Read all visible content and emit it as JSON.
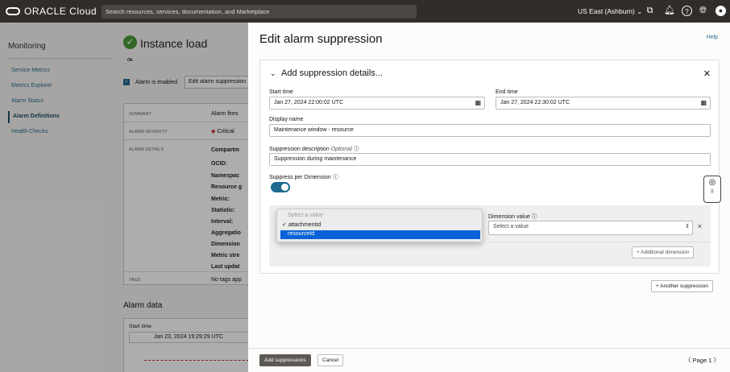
{
  "header": {
    "brand": "ORACLE Cloud",
    "search_placeholder": "Search resources, services, documentation, and Marketplace",
    "region": "US East (Ashburn)"
  },
  "sidebar": {
    "title": "Monitoring",
    "items": [
      {
        "label": "Service Metrics"
      },
      {
        "label": "Metrics Explorer"
      },
      {
        "label": "Alarm Status"
      },
      {
        "label": "Alarm Definitions",
        "active": true
      },
      {
        "label": "Health Checks"
      }
    ]
  },
  "background": {
    "title": "Instance load",
    "status": "Ok",
    "alarm_enabled": "Alarm is enabled",
    "edit_button": "Edit alarm suppression",
    "summary_label": "SUMMARY",
    "summary_value": "Alarm fires",
    "severity_label": "ALARM SEVERITY",
    "severity_value": "Critical",
    "details_label": "ALARM DETAILS",
    "details": [
      "Compartm",
      "OCID:",
      "Namespac",
      "Resource g",
      "Metric:",
      "Statistic:",
      "Interval:",
      "Aggregatio",
      "Dimension",
      "Metric stre",
      "Last updat"
    ],
    "tags_label": "TAGS",
    "tags_value": "No tags app",
    "alarm_data": "Alarm data",
    "start_time_label": "Start time",
    "start_time": "Jan 23, 2024 19:29:29 UTC"
  },
  "drawer": {
    "title": "Edit alarm suppression",
    "help": "Help",
    "card_title": "Add suppression details...",
    "start_time_label": "Start time",
    "start_time": "Jan 27, 2024 22:00:02 UTC",
    "end_time_label": "End time",
    "end_time": "Jan 27, 2024 22:30:02 UTC",
    "display_name_label": "Display name",
    "display_name": "Maintenance window - resource",
    "description_label": "Suppression description",
    "optional": "Optional",
    "description": "Suppression during maintenance",
    "suppress_label": "Suppress per Dimension",
    "suppress_on": true,
    "dropdown": {
      "placeholder": "Select a value",
      "options": [
        "attachmentId",
        "resourceId"
      ],
      "checked": "attachmentId",
      "highlighted": "resourceId"
    },
    "dimension_value_label": "Dimension value",
    "dimension_value_placeholder": "Select a value",
    "additional_dimension": "+ Additional dimension",
    "another_suppression": "+ Another suppression"
  },
  "footer": {
    "add": "Add suppressions",
    "cancel": "Cancel",
    "page": "Page 1"
  }
}
